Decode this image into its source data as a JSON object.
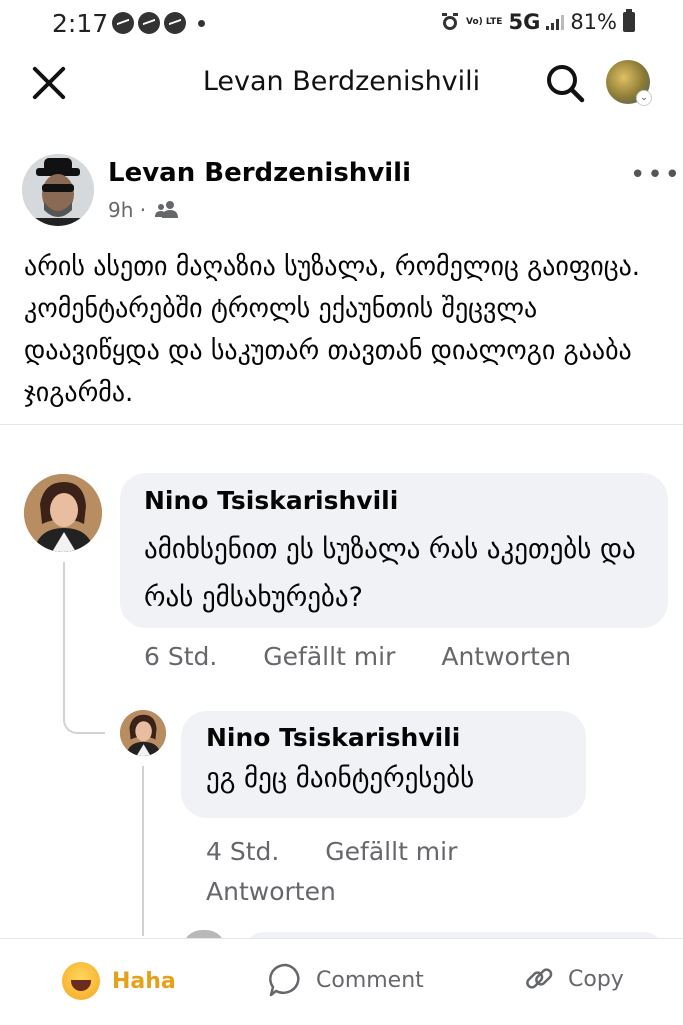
{
  "status_bar": {
    "time": "2:17",
    "network": "5G",
    "volte": "Vo) LTE",
    "battery": "81%"
  },
  "app_bar": {
    "title": "Levan Berdzenishvili"
  },
  "post": {
    "author": "Levan Berdzenishvili",
    "time": "9h",
    "separator": "·",
    "privacy_icon": "friends-icon",
    "text": "არის ასეთი მაღაზია სუზალა, რომელიც გაიფიცა. კომენტარებში ტროლს ექაუნთის შეცვლა დაავიწყდა და საკუთარ თავთან დიალოგი გააბა ჯიგარმა."
  },
  "comments": [
    {
      "author": "Nino Tsiskarishvili",
      "text": "ამიხსენით ეს სუზალა რას აკეთებს და რას ემსახურება?",
      "time": "6 Std.",
      "like": "Gefällt mir",
      "reply": "Antworten"
    },
    {
      "author": "Nino Tsiskarishvili",
      "text": "ეგ მეც მაინტერესებს",
      "time": "4 Std.",
      "like": "Gefällt mir",
      "reply": "Antworten"
    }
  ],
  "actions": {
    "haha": "Haha",
    "comment": "Comment",
    "copy": "Copy"
  },
  "colors": {
    "secondary_text": "#65676b",
    "bubble": "#f0f2f5",
    "haha": "#e6a11b"
  }
}
